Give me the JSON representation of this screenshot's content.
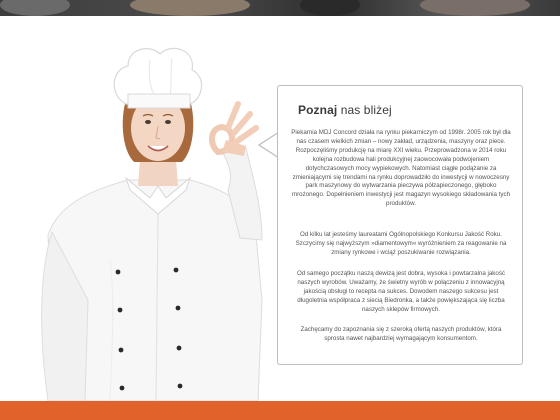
{
  "section": {
    "title_bold": "Poznaj",
    "title_rest": "nas bliżej",
    "paragraphs": [
      "Piekarnia MDJ Concord działa na rynku piekarniczym od 1998r. 2005 rok był dla nas czasem wielkich zmian – nowy zakład, urządzenia, maszyny oraz piece. Rozpoczęliśmy produkcję na miarę XXI wieku. Przeprowadzona w 2014 roku kolejna rozbudowa hali produkcyjnej zaowocowała podwojeniem dotychczasowych mocy wypiekowych. Natomiast ciągłe podążanie za zmieniającymi się trendami na rynku doprowadziło do inwestycji w nowoczesny park maszynowy do wytwarzania pieczywa półzapieczonego, głęboko mrożonego. Dopełnieniem inwestycji jest magazyn wysokiego składowania tych produktów.",
      "Od kilku lat jesteśmy laureatami Ogólnopolskiego Konkursu Jakość Roku. Szczycimy się najwyższym »diamentowym« wyróżnieniem za reagowanie na zmiany rynkowe i wciąż poszukiwanie rozwiązania.",
      "Od samego początku naszą dewizą jest dobra, wysoka i powtarzalna jakość naszych wyrobów. Uważamy, że świetny wyrób w połączeniu z innowacyjną jakością obsługi to recepta na sukces. Dowodem naszego sukcesu jest długoletnia współpraca z siecią Biedronka, a także powiększająca się liczba naszych sklepów firmowych.",
      "Zachęcamy do zapoznania się z szeroką ofertą naszych produktów, która sprosta nawet najbardziej wymagającym konsumentom."
    ]
  },
  "colors": {
    "accent_bar": "#e2622b",
    "bubble_border": "#bdbdbd",
    "text": "#555555"
  }
}
